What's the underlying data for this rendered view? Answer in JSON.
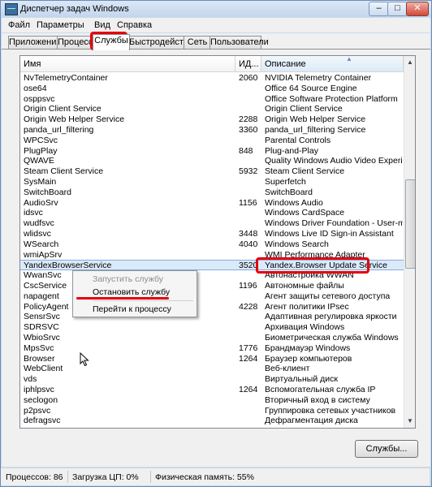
{
  "window": {
    "title": "Диспетчер задач Windows",
    "minimize": "–",
    "maximize": "□",
    "close": "✕"
  },
  "menu": [
    "Файл",
    "Параметры",
    "Вид",
    "Справка"
  ],
  "tabs": [
    "Приложения",
    "Процессы",
    "Службы",
    "Быстродействие",
    "Сеть",
    "Пользователи"
  ],
  "active_tab": "Службы",
  "columns": {
    "name": "Имя",
    "pid": "ИД...",
    "description": "Описание"
  },
  "rows": [
    {
      "name": "NvTelemetryContainer",
      "pid": "2060",
      "desc": "NVIDIA Telemetry Container"
    },
    {
      "name": "ose64",
      "pid": "",
      "desc": "Office 64 Source Engine"
    },
    {
      "name": "osppsvc",
      "pid": "",
      "desc": "Office Software Protection Platform"
    },
    {
      "name": "Origin Client Service",
      "pid": "",
      "desc": "Origin Client Service"
    },
    {
      "name": "Origin Web Helper Service",
      "pid": "2288",
      "desc": "Origin Web Helper Service"
    },
    {
      "name": "panda_url_filtering",
      "pid": "3360",
      "desc": "panda_url_filtering Service"
    },
    {
      "name": "WPCSvc",
      "pid": "",
      "desc": "Parental Controls"
    },
    {
      "name": "PlugPlay",
      "pid": "848",
      "desc": "Plug-and-Play"
    },
    {
      "name": "QWAVE",
      "pid": "",
      "desc": "Quality Windows Audio Video Experience"
    },
    {
      "name": "Steam Client Service",
      "pid": "5932",
      "desc": "Steam Client Service"
    },
    {
      "name": "SysMain",
      "pid": "",
      "desc": "Superfetch"
    },
    {
      "name": "SwitchBoard",
      "pid": "",
      "desc": "SwitchBoard"
    },
    {
      "name": "AudioSrv",
      "pid": "1156",
      "desc": "Windows Audio"
    },
    {
      "name": "idsvc",
      "pid": "",
      "desc": "Windows CardSpace"
    },
    {
      "name": "wudfsvc",
      "pid": "",
      "desc": "Windows Driver Foundation - User-mode Driver"
    },
    {
      "name": "wlidsvc",
      "pid": "3448",
      "desc": "Windows Live ID Sign-in Assistant"
    },
    {
      "name": "WSearch",
      "pid": "4040",
      "desc": "Windows Search"
    },
    {
      "name": "wmiApSrv",
      "pid": "",
      "desc": "WMI Performance Adapter"
    },
    {
      "name": "YandexBrowserService",
      "pid": "3520",
      "desc": "Yandex.Browser Update Service"
    },
    {
      "name": "WwanSvc",
      "pid": "",
      "desc": "Автонастройка WWAN"
    },
    {
      "name": "CscService",
      "pid": "1196",
      "desc": "Автономные файлы"
    },
    {
      "name": "napagent",
      "pid": "",
      "desc": "Агент защиты сетевого доступа"
    },
    {
      "name": "PolicyAgent",
      "pid": "4228",
      "desc": "Агент политики IPsec"
    },
    {
      "name": "SensrSvc",
      "pid": "",
      "desc": "Адаптивная регулировка яркости"
    },
    {
      "name": "SDRSVC",
      "pid": "",
      "desc": "Архивация Windows"
    },
    {
      "name": "WbioSrvc",
      "pid": "",
      "desc": "Биометрическая служба Windows"
    },
    {
      "name": "MpsSvc",
      "pid": "1776",
      "desc": "Брандмауэр Windows"
    },
    {
      "name": "Browser",
      "pid": "1264",
      "desc": "Браузер компьютеров"
    },
    {
      "name": "WebClient",
      "pid": "",
      "desc": "Веб-клиент"
    },
    {
      "name": "vds",
      "pid": "",
      "desc": "Виртуальный диск"
    },
    {
      "name": "iphlpsvc",
      "pid": "1264",
      "desc": "Вспомогательная служба IP"
    },
    {
      "name": "seclogon",
      "pid": "",
      "desc": "Вторичный вход в систему"
    },
    {
      "name": "p2psvc",
      "pid": "",
      "desc": "Группировка сетевых участников"
    },
    {
      "name": "defragsvc",
      "pid": "",
      "desc": "Дефрагментация диска"
    }
  ],
  "selected_row": "YandexBrowserService",
  "context_menu": {
    "start": "Запустить службу",
    "stop": "Остановить службу",
    "goto": "Перейти к процессу"
  },
  "services_button": "Службы...",
  "status": {
    "processes": "Процессов: 86",
    "cpu": "Загрузка ЦП: 0%",
    "memory": "Физическая память: 55%"
  },
  "colors": {
    "highlight": "#e3000f",
    "selection": "#dbeaf8",
    "window_frame": "#c9dbee"
  }
}
